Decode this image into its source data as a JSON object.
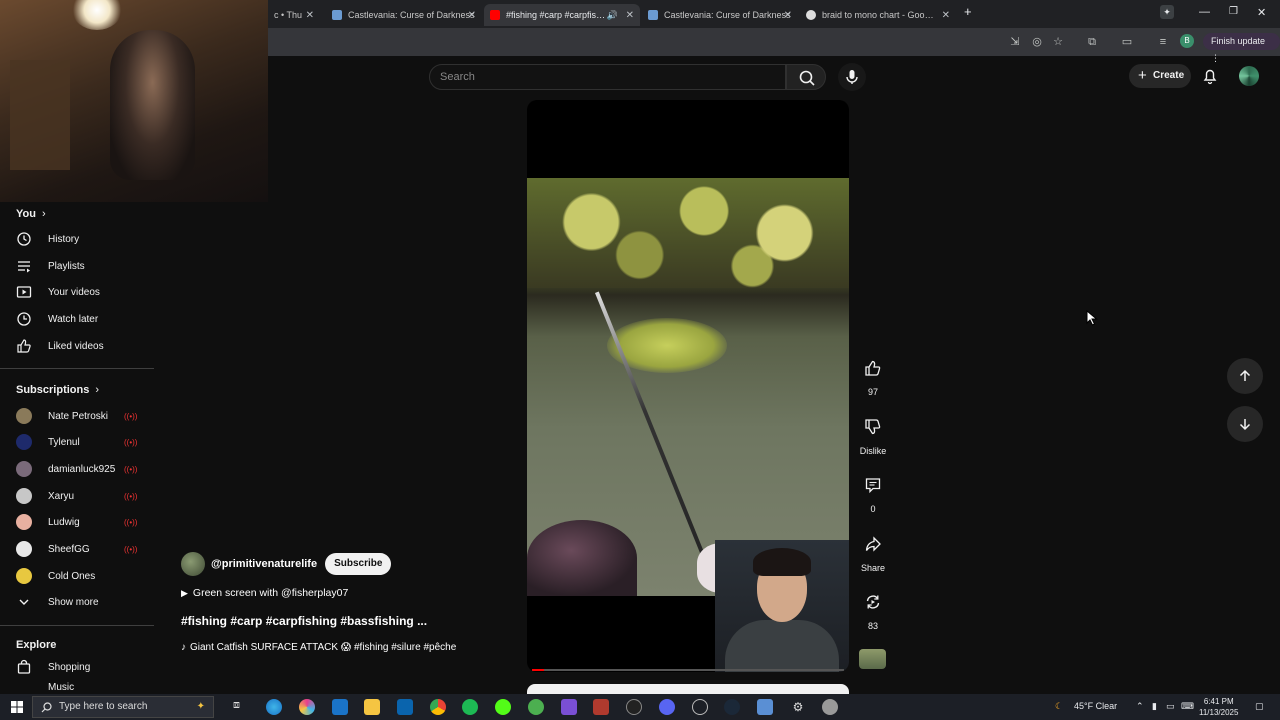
{
  "browser": {
    "tabs": [
      {
        "title": "c • Thu",
        "favicon_color": "#6b6b6b",
        "active": false
      },
      {
        "title": "Castlevania: Curse of Darkness",
        "favicon_color": "#6b9bd2",
        "active": false
      },
      {
        "title": "#fishing #carp #carpfishing",
        "favicon_color": "#ff0000",
        "active": true
      },
      {
        "title": "Castlevania: Curse of Darkness",
        "favicon_color": "#6b9bd2",
        "active": false
      },
      {
        "title": "braid to mono chart - Google S",
        "favicon_color": "#dddddd",
        "active": false
      }
    ],
    "new_tab": "+",
    "finish_update": "Finish update",
    "profile_initial": "B"
  },
  "header": {
    "search_placeholder": "Search",
    "create_label": "Create"
  },
  "sidebar": {
    "you_label": "You",
    "you_items": [
      {
        "label": "History",
        "icon": "history-icon"
      },
      {
        "label": "Playlists",
        "icon": "playlists-icon"
      },
      {
        "label": "Your videos",
        "icon": "your-videos-icon"
      },
      {
        "label": "Watch later",
        "icon": "watch-later-icon"
      },
      {
        "label": "Liked videos",
        "icon": "liked-videos-icon"
      }
    ],
    "subscriptions_label": "Subscriptions",
    "subscriptions": [
      {
        "name": "Nate Petroski",
        "avatar_color": "#8a7a5a",
        "live": true
      },
      {
        "name": "Tylenul",
        "avatar_color": "#1e2a6b",
        "live": true
      },
      {
        "name": "damianluck925",
        "avatar_color": "#7a6a7a",
        "live": true
      },
      {
        "name": "Xaryu",
        "avatar_color": "#c7c7c7",
        "live": true
      },
      {
        "name": "Ludwig",
        "avatar_color": "#e8b0a0",
        "live": true
      },
      {
        "name": "SheefGG",
        "avatar_color": "#e8e8e8",
        "live": true
      },
      {
        "name": "Cold Ones",
        "avatar_color": "#e8c840",
        "live": false
      }
    ],
    "show_more": "Show more",
    "explore_label": "Explore",
    "explore_items": [
      {
        "label": "Shopping",
        "icon": "shopping-bag-icon"
      },
      {
        "label": "Music",
        "icon": "music-icon"
      }
    ]
  },
  "short": {
    "channel": "@primitivenaturelife",
    "subscribe_label": "Subscribe",
    "reference": "Green screen with @fisherplay07",
    "title": "#fishing #carp #carpfishing #bassfishing ...",
    "sound": "Giant Catfish SURFACE ATTACK 😱 #fishing #silure #pêche",
    "progress_fraction": 0.04,
    "actions": {
      "likes": "97",
      "dislike": "Dislike",
      "comments": "0",
      "share": "Share",
      "remix": "83"
    }
  },
  "taskbar": {
    "search_placeholder": "Type here to search",
    "weather": "45°F  Clear",
    "time": "6:41 PM",
    "date": "11/13/2025"
  }
}
